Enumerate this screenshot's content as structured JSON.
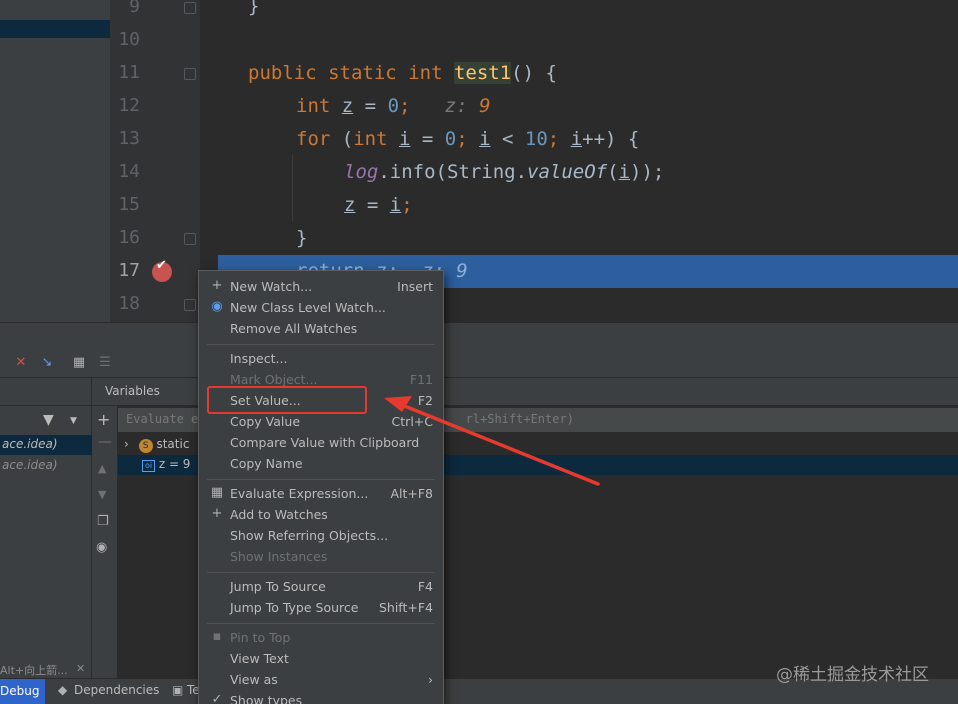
{
  "editor": {
    "lines": [
      {
        "no": "9"
      },
      {
        "no": "10"
      },
      {
        "no": "11"
      },
      {
        "no": "12"
      },
      {
        "no": "13"
      },
      {
        "no": "14"
      },
      {
        "no": "15"
      },
      {
        "no": "16"
      },
      {
        "no": "17"
      },
      {
        "no": "18"
      }
    ],
    "code": {
      "l9_brace": "}",
      "l11_public": "public",
      "l11_static": "static",
      "l11_int": "int",
      "l11_fn": "test1",
      "l11_rest": "() {",
      "l12_int": "int",
      "l12_var": "z",
      "l12_eq": " = ",
      "l12_num": "0",
      "l12_semi": ";",
      "l12_hint_name": "z:",
      "l12_hint_val": "9",
      "l13_for": "for",
      "l13_open": " (",
      "l13_int": "int",
      "l13_i1": "i",
      "l13_eq": " = ",
      "l13_zero": "0",
      "l13_semi1": "; ",
      "l13_i2": "i",
      "l13_lt": " < ",
      "l13_ten": "10",
      "l13_semi2": "; ",
      "l13_i3": "i",
      "l13_inc": "++) {",
      "l14_log": "log",
      "l14_info": ".info(String.",
      "l14_valueof": "valueOf",
      "l14_paren": "(",
      "l14_i": "i",
      "l14_close": "));",
      "l15_z": "z",
      "l15_eq": " = ",
      "l15_i": "i",
      "l15_semi": ";",
      "l16_brace": "}",
      "l17_return": "return",
      "l17_z": "z",
      "l17_semi": ";",
      "l17_hint_name": "z:",
      "l17_hint_val": "9"
    }
  },
  "debug": {
    "variables_title": "Variables",
    "eval_placeholder": "Evaluate e",
    "eval_shortcut_tail": "rl+Shift+Enter)",
    "frames": [
      "ace.idea)",
      "ace.idea)"
    ],
    "variables": [
      {
        "expand": "›",
        "badge": "S",
        "label": "static"
      },
      {
        "badge": "oi",
        "label": "z = 9"
      }
    ],
    "footnote": "Alt+向上箭...",
    "bottom_tabs": [
      "Debug",
      "Dependencies",
      "Te"
    ]
  },
  "context_menu": {
    "items": [
      {
        "icon": "+",
        "label": "New Watch...",
        "shortcut": "Insert",
        "disabled": false
      },
      {
        "icon": "◉",
        "label": "New Class Level Watch...",
        "shortcut": "",
        "disabled": false
      },
      {
        "icon": "",
        "label": "Remove All Watches",
        "shortcut": "",
        "disabled": false
      },
      {
        "icon": "",
        "label": "Inspect...",
        "shortcut": "",
        "disabled": false
      },
      {
        "icon": "",
        "label": "Mark Object...",
        "shortcut": "F11",
        "disabled": true
      },
      {
        "icon": "",
        "label": "Set Value...",
        "shortcut": "F2",
        "disabled": false
      },
      {
        "icon": "",
        "label": "Copy Value",
        "shortcut": "Ctrl+C",
        "disabled": false
      },
      {
        "icon": "",
        "label": "Compare Value with Clipboard",
        "shortcut": "",
        "disabled": false
      },
      {
        "icon": "",
        "label": "Copy Name",
        "shortcut": "",
        "disabled": false
      },
      {
        "icon": "▦",
        "label": "Evaluate Expression...",
        "shortcut": "Alt+F8",
        "disabled": false
      },
      {
        "icon": "+",
        "label": "Add to Watches",
        "shortcut": "",
        "disabled": false
      },
      {
        "icon": "",
        "label": "Show Referring Objects...",
        "shortcut": "",
        "disabled": false
      },
      {
        "icon": "",
        "label": "Show Instances",
        "shortcut": "",
        "disabled": true
      },
      {
        "icon": "",
        "label": "Jump To Source",
        "shortcut": "F4",
        "disabled": false
      },
      {
        "icon": "",
        "label": "Jump To Type Source",
        "shortcut": "Shift+F4",
        "disabled": false
      },
      {
        "icon": "",
        "label": "Pin to Top",
        "shortcut": "",
        "disabled": true
      },
      {
        "icon": "",
        "label": "View Text",
        "shortcut": "",
        "disabled": false
      },
      {
        "icon": "",
        "label": "View as",
        "shortcut": "›",
        "disabled": false
      },
      {
        "icon": "✓",
        "label": "Show types",
        "shortcut": "",
        "disabled": false
      }
    ]
  },
  "annotation": {
    "box_color": "#e63a2e",
    "arrow_color": "#e63a2e"
  },
  "watermark": "@稀土掘金技术社区"
}
